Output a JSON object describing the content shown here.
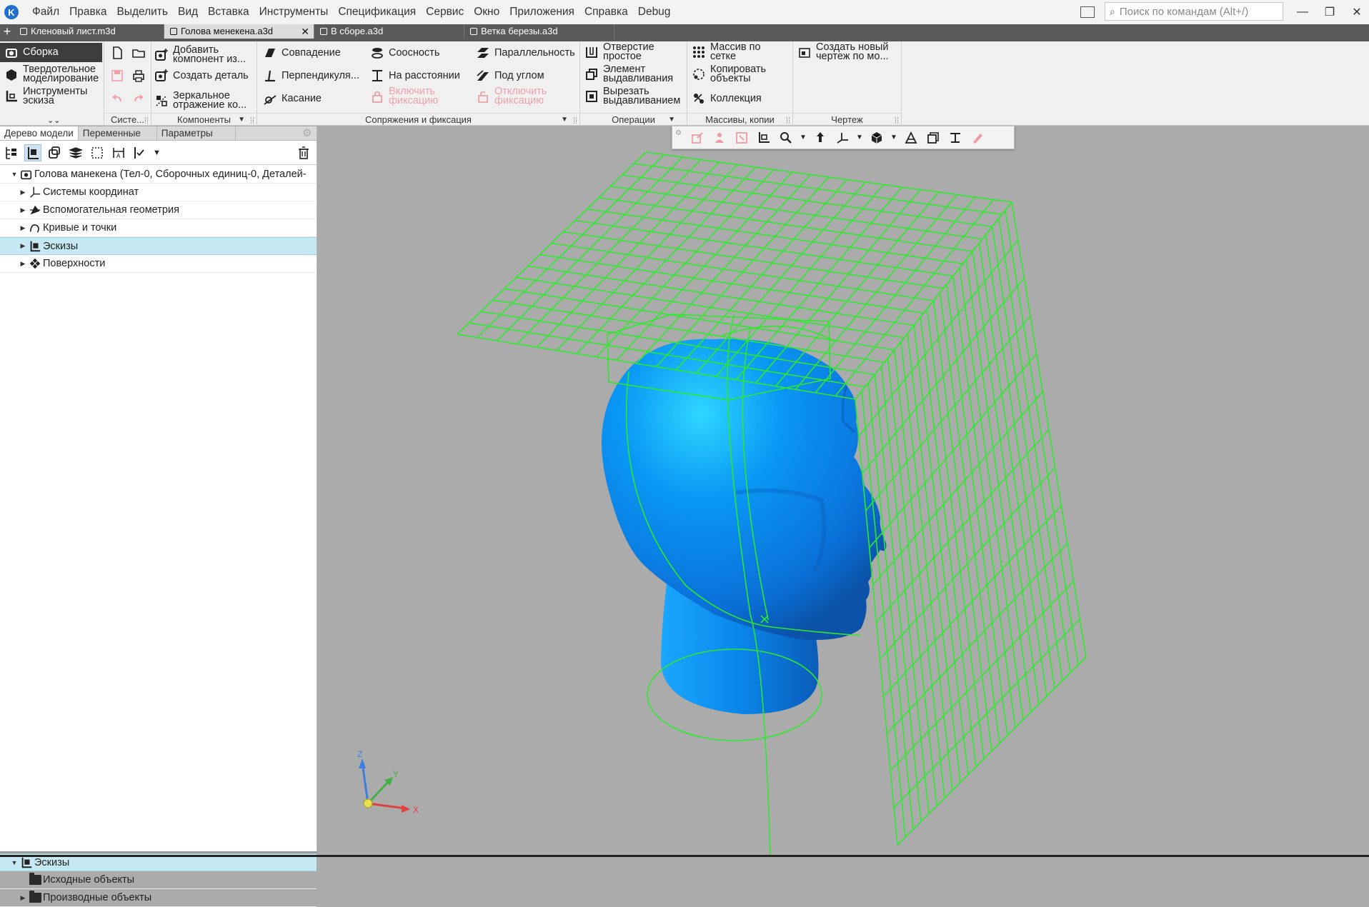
{
  "menu": {
    "logo": "K",
    "items": [
      "Файл",
      "Правка",
      "Выделить",
      "Вид",
      "Вставка",
      "Инструменты",
      "Спецификация",
      "Сервис",
      "Окно",
      "Приложения",
      "Справка",
      "Debug"
    ],
    "search_placeholder": "Поиск по командам (Alt+/)"
  },
  "tabs": [
    {
      "label": "Кленовый лист.m3d",
      "active": false
    },
    {
      "label": "Голова менекена.a3d",
      "active": true
    },
    {
      "label": "В сборе.a3d",
      "active": false
    },
    {
      "label": "Ветка березы.a3d",
      "active": false
    }
  ],
  "ribbon": {
    "modes": {
      "assembly": "Сборка",
      "solid": "Твердотельное моделирование",
      "sketch": "Инструменты эскиза"
    },
    "groups": {
      "system": "Систе...",
      "components": "Компоненты",
      "mates": "Сопряжения и фиксация",
      "operations": "Операции",
      "arrays": "Массивы, копии",
      "drawing": "Чертеж"
    },
    "components": {
      "add": "Добавить компонент из...",
      "create_part": "Создать деталь",
      "mirror": "Зеркальное отражение ко..."
    },
    "mates": {
      "coincidence": "Совпадение",
      "perpendicular": "Перпендикуля...",
      "tangent": "Касание",
      "coaxial": "Соосность",
      "distance": "На расстоянии",
      "enable_fix": "Включить фиксацию",
      "parallel": "Параллельность",
      "angle": "Под углом",
      "disable_fix": "Отключить фиксацию"
    },
    "operations": {
      "hole": "Отверстие простое",
      "extrude": "Элемент выдавливания",
      "cut": "Вырезать выдавливанием"
    },
    "arrays": {
      "grid": "Массив по сетке",
      "copy": "Копировать объекты",
      "collection": "Коллекция"
    },
    "drawing": {
      "new": "Создать новый чертеж по мо..."
    }
  },
  "panel": {
    "tabs": [
      "Дерево модели",
      "Переменные",
      "Параметры"
    ],
    "tree": [
      {
        "label": "Голова манекена (Тел-0, Сборочных единиц-0, Деталей-",
        "icon": "assembly-icon",
        "level": 0,
        "expanded": true
      },
      {
        "label": "Системы координат",
        "icon": "coordinate-systems-icon",
        "level": 1
      },
      {
        "label": "Вспомогательная геометрия",
        "icon": "aux-geometry-icon",
        "level": 1
      },
      {
        "label": "Кривые и точки",
        "icon": "curves-icon",
        "level": 1
      },
      {
        "label": "Эскизы",
        "icon": "sketches-icon",
        "level": 1,
        "selected": true
      },
      {
        "label": "Поверхности",
        "icon": "surfaces-icon",
        "level": 1
      }
    ],
    "lower_tree": [
      {
        "label": "Эскизы",
        "icon": "sketches-icon",
        "level": 0,
        "expanded": true
      },
      {
        "label": "Исходные объекты",
        "icon": "folder-icon",
        "level": 1
      },
      {
        "label": "Производные объекты",
        "icon": "folder-icon",
        "level": 1
      }
    ]
  },
  "axes": {
    "x": "X",
    "y": "Y",
    "z": "Z"
  },
  "colors": {
    "wire": "#2ee82e",
    "head": "#0a8ff0",
    "head_dark": "#0b5db8",
    "viewport": "#ababab",
    "selection": "#c6e8f3"
  }
}
